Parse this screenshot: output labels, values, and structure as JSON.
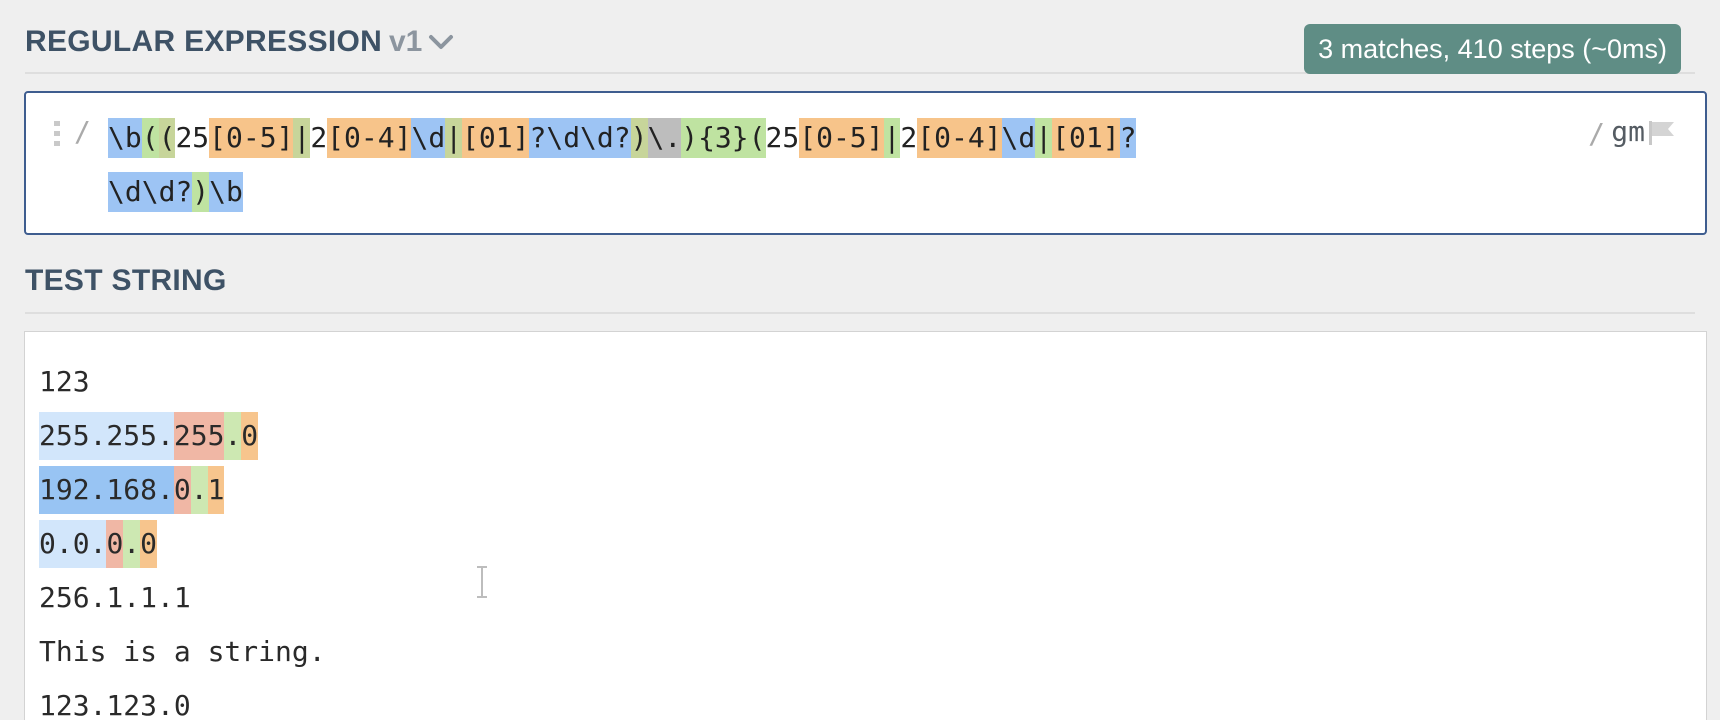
{
  "regex_section": {
    "title": "REGULAR EXPRESSION",
    "flavor": "v1",
    "match_info": "3 matches, 410 steps (~0ms)",
    "delimiter_open": "/",
    "delimiter_close": "/",
    "flags": "gm",
    "line1_tokens": [
      {
        "text": "\\b",
        "style": "blue"
      },
      {
        "text": "(",
        "style": "green"
      },
      {
        "text": "(",
        "style": "olive"
      },
      {
        "text": "25",
        "style": "plain"
      },
      {
        "text": "[0-5]",
        "style": "orange"
      },
      {
        "text": "|",
        "style": "olive"
      },
      {
        "text": "2",
        "style": "plain"
      },
      {
        "text": "[0-4]",
        "style": "orange"
      },
      {
        "text": "\\d",
        "style": "blue"
      },
      {
        "text": "|",
        "style": "olive"
      },
      {
        "text": "[01]",
        "style": "orange"
      },
      {
        "text": "?\\d\\d?",
        "style": "blue"
      },
      {
        "text": ")",
        "style": "olive"
      },
      {
        "text": "\\.",
        "style": "gray"
      },
      {
        "text": "){3}(",
        "style": "green"
      },
      {
        "text": "25",
        "style": "plain"
      },
      {
        "text": "[0-5]",
        "style": "orange"
      },
      {
        "text": "|",
        "style": "green"
      },
      {
        "text": "2",
        "style": "plain"
      },
      {
        "text": "[0-4]",
        "style": "orange"
      },
      {
        "text": "\\d",
        "style": "blue"
      },
      {
        "text": "|",
        "style": "green"
      },
      {
        "text": "[01]",
        "style": "orange"
      },
      {
        "text": "?",
        "style": "blue"
      }
    ],
    "line2_tokens": [
      {
        "text": "\\d\\d?",
        "style": "blue"
      },
      {
        "text": ")",
        "style": "green"
      },
      {
        "text": "\\b",
        "style": "blue"
      }
    ]
  },
  "test_section": {
    "title": "TEST STRING",
    "lines": [
      [
        {
          "text": "123",
          "style": "none"
        }
      ],
      [
        {
          "text": "255.255.",
          "style": "light"
        },
        {
          "text": "255",
          "style": "red"
        },
        {
          "text": ".",
          "style": "green"
        },
        {
          "text": "0",
          "style": "orange"
        }
      ],
      [
        {
          "text": "192.168.",
          "style": "blue"
        },
        {
          "text": "0",
          "style": "red"
        },
        {
          "text": ".",
          "style": "green"
        },
        {
          "text": "1",
          "style": "orange"
        }
      ],
      [
        {
          "text": "0.0.",
          "style": "light"
        },
        {
          "text": "0",
          "style": "red"
        },
        {
          "text": ".",
          "style": "green"
        },
        {
          "text": "0",
          "style": "orange"
        }
      ],
      [
        {
          "text": "256.1.1.1",
          "style": "none"
        }
      ],
      [
        {
          "text": "This is a string.",
          "style": "none"
        }
      ],
      [
        {
          "text": "123.123.0",
          "style": "none"
        }
      ]
    ]
  },
  "colors": {
    "header_text": "#3e5266",
    "badge_bg": "#5f8d85",
    "editor_border": "#3e5d8f"
  },
  "icons": [
    "chevron-down-icon",
    "drag-handle-icon",
    "flag-icon",
    "text-cursor-icon"
  ]
}
